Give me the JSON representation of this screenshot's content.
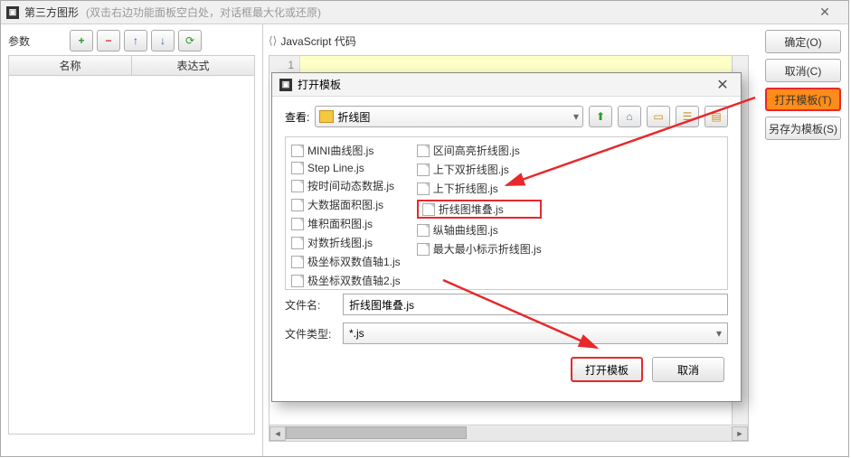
{
  "window": {
    "title": "第三方图形",
    "hint": "(双击右边功能面板空白处，对话框最大化或还原)"
  },
  "params": {
    "label": "参数",
    "col_name": "名称",
    "col_expr": "表达式"
  },
  "code": {
    "label": "JavaScript 代码",
    "line1": "1"
  },
  "buttons": {
    "ok": "确定(O)",
    "cancel": "取消(C)",
    "open_tpl": "打开模板(T)",
    "save_as_tpl": "另存为模板(S)"
  },
  "dialog": {
    "title": "打开模板",
    "look_label": "查看:",
    "folder": "折线图",
    "filename_label": "文件名:",
    "filename_value": "折线图堆叠.js",
    "filetype_label": "文件类型:",
    "filetype_value": "*.js",
    "open_btn": "打开模板",
    "cancel_btn": "取消",
    "files_col1": [
      "MINI曲线图.js",
      "Step Line.js",
      "按时间动态数据.js",
      "大数据面积图.js",
      "堆积面积图.js",
      "对数折线图.js",
      "极坐标双数值轴1.js",
      "极坐标双数值轴2.js"
    ],
    "files_col2": [
      "区间高亮折线图.js",
      "上下双折线图.js",
      "上下折线图.js",
      "折线图堆叠.js",
      "纵轴曲线图.js",
      "最大最小标示折线图.js"
    ]
  }
}
